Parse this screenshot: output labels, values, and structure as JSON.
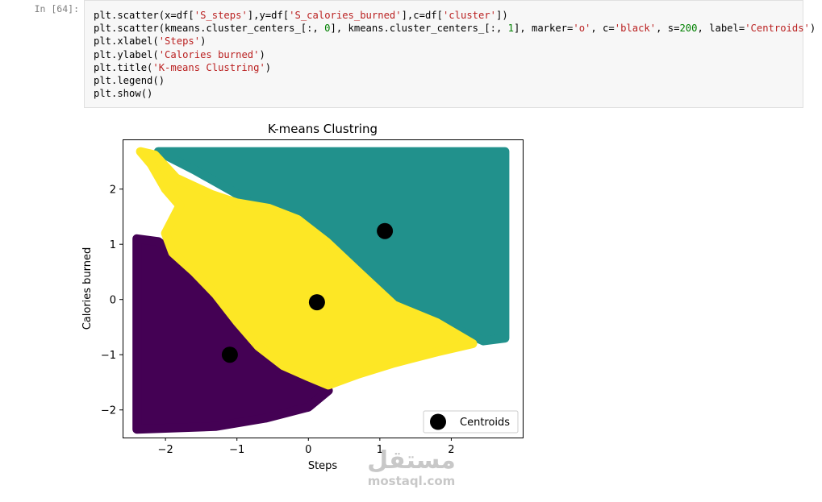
{
  "cell": {
    "prompt": "In [64]:",
    "code_lines": [
      [
        [
          "plt.scatter(x=df[",
          ""
        ],
        [
          "'S_steps'",
          "str"
        ],
        [
          "],y=df[",
          ""
        ],
        [
          "'S_calories_burned'",
          "str"
        ],
        [
          "],c=df[",
          ""
        ],
        [
          "'cluster'",
          "str"
        ],
        [
          "])",
          ""
        ]
      ],
      [
        [
          "plt.scatter(kmeans.cluster_centers_[:, ",
          ""
        ],
        [
          "0",
          "num"
        ],
        [
          "], kmeans.cluster_centers_[:, ",
          ""
        ],
        [
          "1",
          "num"
        ],
        [
          "], marker=",
          ""
        ],
        [
          "'o'",
          "str"
        ],
        [
          ", c=",
          ""
        ],
        [
          "'black'",
          "str"
        ],
        [
          ", s=",
          ""
        ],
        [
          "200",
          "num"
        ],
        [
          ", label=",
          ""
        ],
        [
          "'Centroids'",
          "str"
        ],
        [
          ")",
          ""
        ]
      ],
      [
        [
          "plt.xlabel(",
          ""
        ],
        [
          "'Steps'",
          "str"
        ],
        [
          ")",
          ""
        ]
      ],
      [
        [
          "plt.ylabel(",
          ""
        ],
        [
          "'Calories burned'",
          "str"
        ],
        [
          ")",
          ""
        ]
      ],
      [
        [
          "plt.title(",
          ""
        ],
        [
          "'K-means Clustring'",
          "str"
        ],
        [
          ")",
          ""
        ]
      ],
      [
        [
          "plt.legend()",
          ""
        ]
      ],
      [
        [
          "plt.show()",
          ""
        ]
      ]
    ]
  },
  "chart_data": {
    "type": "scatter",
    "title": "K-means Clustring",
    "xlabel": "Steps",
    "ylabel": "Calories burned",
    "xlim": [
      -2.6,
      3.0
    ],
    "ylim": [
      -2.5,
      2.9
    ],
    "xticks": [
      -2,
      -1,
      0,
      1,
      2
    ],
    "yticks": [
      -2,
      -1,
      0,
      1,
      2
    ],
    "grid": false,
    "legend": {
      "placement": "lower-right",
      "entries": [
        "Centroids"
      ]
    },
    "clusters": [
      {
        "color": "#440154",
        "region": [
          [
            -2.4,
            1.1
          ],
          [
            -2.1,
            1.05
          ],
          [
            -1.85,
            0.8
          ],
          [
            -1.6,
            0.4
          ],
          [
            -1.3,
            0.05
          ],
          [
            -1.0,
            -0.45
          ],
          [
            -0.7,
            -0.9
          ],
          [
            -0.35,
            -1.3
          ],
          [
            0.1,
            -1.5
          ],
          [
            0.28,
            -1.65
          ],
          [
            0.0,
            -1.95
          ],
          [
            -0.6,
            -2.15
          ],
          [
            -1.3,
            -2.3
          ],
          [
            -2.4,
            -2.35
          ]
        ]
      },
      {
        "color": "#21918c",
        "region": [
          [
            -2.1,
            2.68
          ],
          [
            2.75,
            2.68
          ],
          [
            2.75,
            -0.7
          ],
          [
            2.45,
            -0.75
          ],
          [
            2.1,
            -0.55
          ],
          [
            1.75,
            -0.38
          ],
          [
            1.2,
            -0.1
          ],
          [
            0.6,
            0.55
          ],
          [
            0.2,
            1.05
          ],
          [
            -0.35,
            1.5
          ],
          [
            -0.75,
            1.7
          ],
          [
            -1.05,
            1.95
          ],
          [
            -1.6,
            2.35
          ]
        ]
      },
      {
        "color": "#fde725",
        "region": [
          [
            -2.35,
            2.68
          ],
          [
            -2.15,
            2.62
          ],
          [
            -1.85,
            2.2
          ],
          [
            -1.35,
            1.9
          ],
          [
            -1.0,
            1.75
          ],
          [
            -0.55,
            1.65
          ],
          [
            -0.15,
            1.45
          ],
          [
            0.25,
            1.05
          ],
          [
            0.7,
            0.5
          ],
          [
            1.2,
            -0.1
          ],
          [
            1.8,
            -0.42
          ],
          [
            2.3,
            -0.8
          ],
          [
            1.8,
            -0.95
          ],
          [
            1.2,
            -1.15
          ],
          [
            0.7,
            -1.35
          ],
          [
            0.28,
            -1.55
          ],
          [
            0.0,
            -1.4
          ],
          [
            -0.35,
            -1.2
          ],
          [
            -0.7,
            -0.85
          ],
          [
            -1.0,
            -0.4
          ],
          [
            -1.3,
            0.1
          ],
          [
            -1.6,
            0.5
          ],
          [
            -1.9,
            0.85
          ],
          [
            -2.0,
            1.2
          ],
          [
            -1.8,
            1.7
          ],
          [
            -2.0,
            2.0
          ],
          [
            -2.2,
            2.45
          ]
        ]
      }
    ],
    "centroids": [
      {
        "x": -1.1,
        "y": -1.0
      },
      {
        "x": 0.12,
        "y": -0.05
      },
      {
        "x": 1.07,
        "y": 1.24
      }
    ],
    "centroid_color": "#000000"
  },
  "watermark": {
    "arabic": "مستقل",
    "latin": "mostaql.com"
  }
}
